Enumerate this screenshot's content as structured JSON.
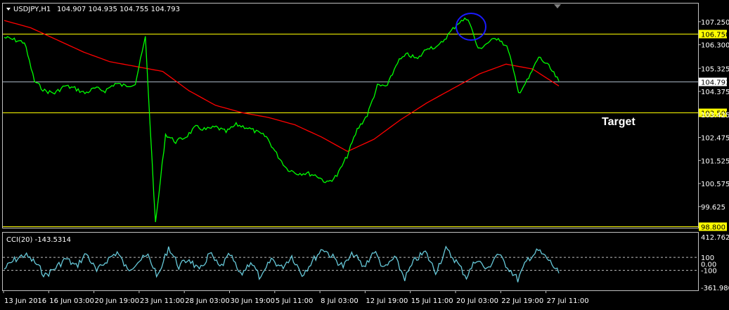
{
  "main_panel": {
    "header": {
      "symbol": "USDJPY,H1",
      "ohlc": "104.907 104.935 104.755 104.793"
    },
    "annotation_text": "Target"
  },
  "cci_panel": {
    "header": "CCI(20) -143.5314"
  },
  "colors": {
    "background": "#000000",
    "price_line": "#00ff00",
    "moving_average": "#ff0000",
    "horizontal_levels": "#ffff00",
    "current_price_line": "#a9b6c4",
    "cci_line": "#66c8d8",
    "highlight_circle": "#1a1aff",
    "frame": "#c0c0c0",
    "text": "#ffffff"
  },
  "chart_data": [
    {
      "type": "line",
      "title": "USDJPY,H1",
      "x": [
        "13 Jun 2016",
        "16 Jun 03:00",
        "20 Jun 19:00",
        "23 Jun 11:00",
        "28 Jun 03:00",
        "30 Jun 19:00",
        "5 Jul 11:00",
        "8 Jul 03:00",
        "12 Jul 19:00",
        "15 Jul 11:00",
        "20 Jul 03:00",
        "22 Jul 19:00",
        "27 Jul 11:00"
      ],
      "price_axis": {
        "ylim": [
          98.75,
          108.0
        ],
        "ticks": [
          "107.250",
          "106.300",
          "105.325",
          "104.375",
          "103.425",
          "102.475",
          "101.525",
          "100.575",
          "99.625"
        ],
        "tick_values": [
          107.25,
          106.3,
          105.325,
          104.375,
          103.425,
          102.475,
          101.525,
          100.575,
          99.625
        ]
      },
      "series": [
        {
          "name": "USDJPY",
          "values": [
            106.6,
            106.5,
            106.4,
            104.8,
            104.4,
            104.3,
            104.6,
            104.5,
            104.3,
            104.5,
            104.4,
            104.7,
            104.6,
            104.7,
            106.6,
            98.9,
            102.6,
            102.3,
            102.5,
            102.9,
            102.8,
            102.9,
            102.7,
            103.0,
            102.9,
            102.7,
            102.5,
            101.8,
            101.2,
            101.0,
            101.0,
            100.9,
            100.6,
            100.9,
            101.7,
            102.8,
            103.4,
            104.6,
            104.6,
            105.6,
            105.9,
            105.7,
            106.2,
            106.2,
            106.7,
            107.2,
            107.4,
            106.1,
            106.4,
            106.6,
            106.1,
            104.3,
            104.9,
            105.8,
            105.4,
            104.8
          ]
        },
        {
          "name": "MA",
          "values": [
            107.3,
            107.0,
            106.5,
            106.0,
            105.6,
            105.4,
            105.2,
            104.4,
            103.8,
            103.5,
            103.3,
            103.0,
            102.5,
            101.9,
            102.4,
            103.2,
            103.9,
            104.5,
            105.1,
            105.5,
            105.3,
            104.6
          ]
        }
      ],
      "horizontal_levels": [
        {
          "label": "106.750",
          "value": 106.75
        },
        {
          "label": "103.500",
          "value": 103.5
        },
        {
          "label": "98.800",
          "value": 98.8
        }
      ],
      "current_price": {
        "label": "104.793",
        "value": 104.793
      }
    },
    {
      "type": "line",
      "title": "CCI(20) -143.5314",
      "cci_axis": {
        "ylim": [
          -362,
          413
        ],
        "ticks": [
          "412.7625",
          "100",
          "0.00",
          "-100",
          "-361.9809"
        ],
        "tick_values": [
          412.7625,
          100,
          0,
          -100,
          -361.9809
        ]
      },
      "series": [
        {
          "name": "CCI",
          "values": [
            -80,
            60,
            140,
            20,
            -180,
            -60,
            80,
            -40,
            160,
            -120,
            60,
            180,
            -100,
            40,
            120,
            -200,
            260,
            -40,
            80,
            -120,
            160,
            -60,
            140,
            -180,
            40,
            -240,
            80,
            -60,
            120,
            -160,
            40,
            240,
            100,
            -40,
            160,
            -60,
            200,
            -80,
            100,
            -220,
            60,
            180,
            -120,
            220,
            40,
            -200,
            80,
            -100,
            160,
            -40,
            -240,
            80,
            200,
            60,
            -143
          ]
        }
      ]
    }
  ]
}
